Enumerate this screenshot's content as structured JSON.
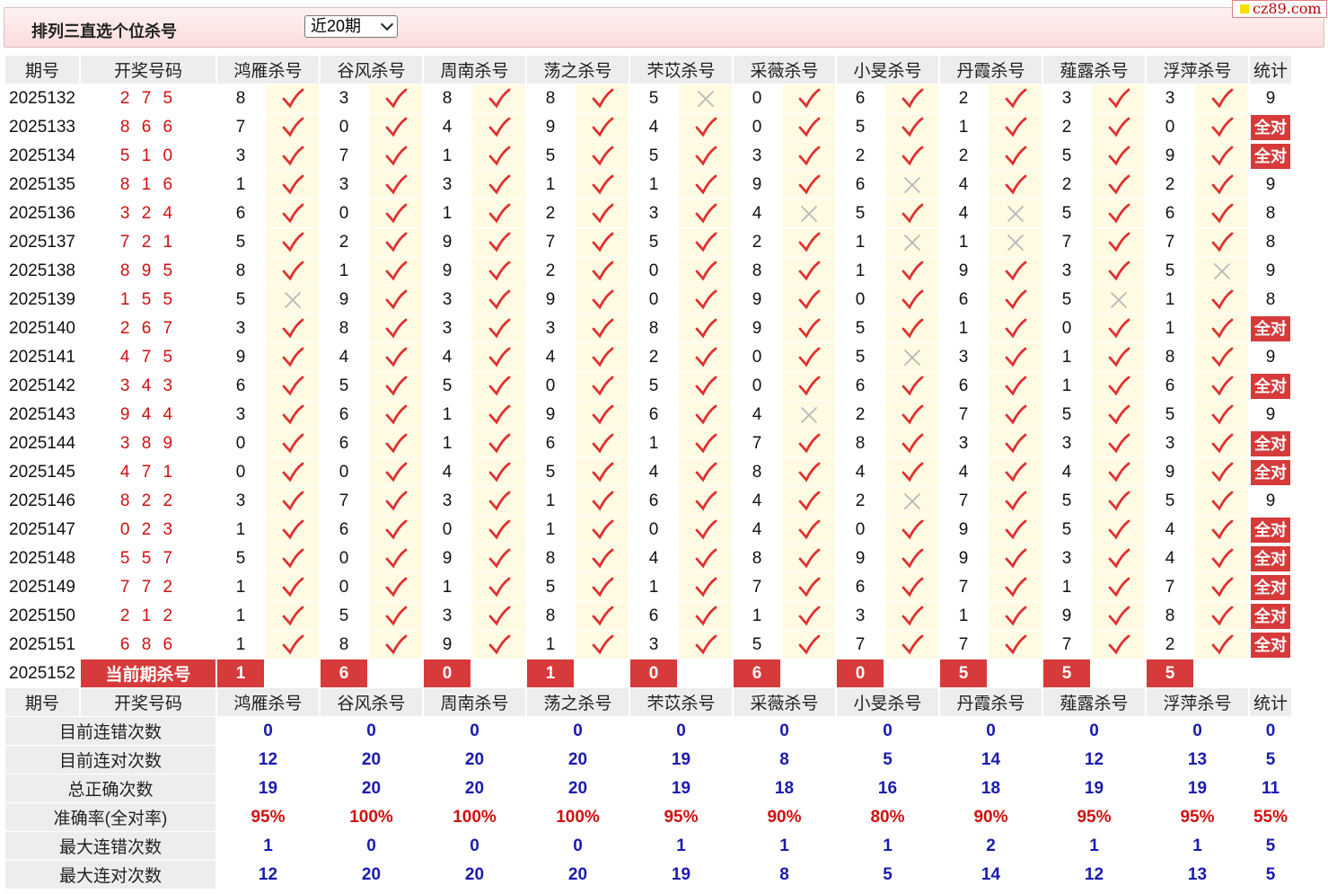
{
  "header": {
    "title": "排列三直选个位杀号",
    "period_select": "近20期"
  },
  "watermark": "cz89.com",
  "columns": [
    "期号",
    "开奖号码",
    "鸿雁杀号",
    "谷风杀号",
    "周南杀号",
    "荡之杀号",
    "芣苡杀号",
    "采薇杀号",
    "小旻杀号",
    "丹霞杀号",
    "薤露杀号",
    "浮萍杀号",
    "统计"
  ],
  "full_label": "全对",
  "rows": [
    {
      "issue": "2025132",
      "draw": "2 7 5",
      "kills": [
        [
          8,
          1
        ],
        [
          3,
          1
        ],
        [
          8,
          1
        ],
        [
          8,
          1
        ],
        [
          5,
          0
        ],
        [
          0,
          1
        ],
        [
          6,
          1
        ],
        [
          2,
          1
        ],
        [
          3,
          1
        ],
        [
          3,
          1
        ]
      ],
      "stat": "9"
    },
    {
      "issue": "2025133",
      "draw": "8 6 6",
      "kills": [
        [
          7,
          1
        ],
        [
          0,
          1
        ],
        [
          4,
          1
        ],
        [
          9,
          1
        ],
        [
          4,
          1
        ],
        [
          0,
          1
        ],
        [
          5,
          1
        ],
        [
          1,
          1
        ],
        [
          2,
          1
        ],
        [
          0,
          1
        ]
      ],
      "stat": "全对"
    },
    {
      "issue": "2025134",
      "draw": "5 1 0",
      "kills": [
        [
          3,
          1
        ],
        [
          7,
          1
        ],
        [
          1,
          1
        ],
        [
          5,
          1
        ],
        [
          5,
          1
        ],
        [
          3,
          1
        ],
        [
          2,
          1
        ],
        [
          2,
          1
        ],
        [
          5,
          1
        ],
        [
          9,
          1
        ]
      ],
      "stat": "全对"
    },
    {
      "issue": "2025135",
      "draw": "8 1 6",
      "kills": [
        [
          1,
          1
        ],
        [
          3,
          1
        ],
        [
          3,
          1
        ],
        [
          1,
          1
        ],
        [
          1,
          1
        ],
        [
          9,
          1
        ],
        [
          6,
          0
        ],
        [
          4,
          1
        ],
        [
          2,
          1
        ],
        [
          2,
          1
        ]
      ],
      "stat": "9"
    },
    {
      "issue": "2025136",
      "draw": "3 2 4",
      "kills": [
        [
          6,
          1
        ],
        [
          0,
          1
        ],
        [
          1,
          1
        ],
        [
          2,
          1
        ],
        [
          3,
          1
        ],
        [
          4,
          0
        ],
        [
          5,
          1
        ],
        [
          4,
          0
        ],
        [
          5,
          1
        ],
        [
          6,
          1
        ]
      ],
      "stat": "8"
    },
    {
      "issue": "2025137",
      "draw": "7 2 1",
      "kills": [
        [
          5,
          1
        ],
        [
          2,
          1
        ],
        [
          9,
          1
        ],
        [
          7,
          1
        ],
        [
          5,
          1
        ],
        [
          2,
          1
        ],
        [
          1,
          0
        ],
        [
          1,
          0
        ],
        [
          7,
          1
        ],
        [
          7,
          1
        ]
      ],
      "stat": "8"
    },
    {
      "issue": "2025138",
      "draw": "8 9 5",
      "kills": [
        [
          8,
          1
        ],
        [
          1,
          1
        ],
        [
          9,
          1
        ],
        [
          2,
          1
        ],
        [
          0,
          1
        ],
        [
          8,
          1
        ],
        [
          1,
          1
        ],
        [
          9,
          1
        ],
        [
          3,
          1
        ],
        [
          5,
          0
        ]
      ],
      "stat": "9"
    },
    {
      "issue": "2025139",
      "draw": "1 5 5",
      "kills": [
        [
          5,
          0
        ],
        [
          9,
          1
        ],
        [
          3,
          1
        ],
        [
          9,
          1
        ],
        [
          0,
          1
        ],
        [
          9,
          1
        ],
        [
          0,
          1
        ],
        [
          6,
          1
        ],
        [
          5,
          0
        ],
        [
          1,
          1
        ]
      ],
      "stat": "8"
    },
    {
      "issue": "2025140",
      "draw": "2 6 7",
      "kills": [
        [
          3,
          1
        ],
        [
          8,
          1
        ],
        [
          3,
          1
        ],
        [
          3,
          1
        ],
        [
          8,
          1
        ],
        [
          9,
          1
        ],
        [
          5,
          1
        ],
        [
          1,
          1
        ],
        [
          0,
          1
        ],
        [
          1,
          1
        ]
      ],
      "stat": "全对"
    },
    {
      "issue": "2025141",
      "draw": "4 7 5",
      "kills": [
        [
          9,
          1
        ],
        [
          4,
          1
        ],
        [
          4,
          1
        ],
        [
          4,
          1
        ],
        [
          2,
          1
        ],
        [
          0,
          1
        ],
        [
          5,
          0
        ],
        [
          3,
          1
        ],
        [
          1,
          1
        ],
        [
          8,
          1
        ]
      ],
      "stat": "9"
    },
    {
      "issue": "2025142",
      "draw": "3 4 3",
      "kills": [
        [
          6,
          1
        ],
        [
          5,
          1
        ],
        [
          5,
          1
        ],
        [
          0,
          1
        ],
        [
          5,
          1
        ],
        [
          0,
          1
        ],
        [
          6,
          1
        ],
        [
          6,
          1
        ],
        [
          1,
          1
        ],
        [
          6,
          1
        ]
      ],
      "stat": "全对"
    },
    {
      "issue": "2025143",
      "draw": "9 4 4",
      "kills": [
        [
          3,
          1
        ],
        [
          6,
          1
        ],
        [
          1,
          1
        ],
        [
          9,
          1
        ],
        [
          6,
          1
        ],
        [
          4,
          0
        ],
        [
          2,
          1
        ],
        [
          7,
          1
        ],
        [
          5,
          1
        ],
        [
          5,
          1
        ]
      ],
      "stat": "9"
    },
    {
      "issue": "2025144",
      "draw": "3 8 9",
      "kills": [
        [
          0,
          1
        ],
        [
          6,
          1
        ],
        [
          1,
          1
        ],
        [
          6,
          1
        ],
        [
          1,
          1
        ],
        [
          7,
          1
        ],
        [
          8,
          1
        ],
        [
          3,
          1
        ],
        [
          3,
          1
        ],
        [
          3,
          1
        ]
      ],
      "stat": "全对"
    },
    {
      "issue": "2025145",
      "draw": "4 7 1",
      "kills": [
        [
          0,
          1
        ],
        [
          0,
          1
        ],
        [
          4,
          1
        ],
        [
          5,
          1
        ],
        [
          4,
          1
        ],
        [
          8,
          1
        ],
        [
          4,
          1
        ],
        [
          4,
          1
        ],
        [
          4,
          1
        ],
        [
          9,
          1
        ]
      ],
      "stat": "全对"
    },
    {
      "issue": "2025146",
      "draw": "8 2 2",
      "kills": [
        [
          3,
          1
        ],
        [
          7,
          1
        ],
        [
          3,
          1
        ],
        [
          1,
          1
        ],
        [
          6,
          1
        ],
        [
          4,
          1
        ],
        [
          2,
          0
        ],
        [
          7,
          1
        ],
        [
          5,
          1
        ],
        [
          5,
          1
        ]
      ],
      "stat": "9"
    },
    {
      "issue": "2025147",
      "draw": "0 2 3",
      "kills": [
        [
          1,
          1
        ],
        [
          6,
          1
        ],
        [
          0,
          1
        ],
        [
          1,
          1
        ],
        [
          0,
          1
        ],
        [
          4,
          1
        ],
        [
          0,
          1
        ],
        [
          9,
          1
        ],
        [
          5,
          1
        ],
        [
          4,
          1
        ]
      ],
      "stat": "全对"
    },
    {
      "issue": "2025148",
      "draw": "5 5 7",
      "kills": [
        [
          5,
          1
        ],
        [
          0,
          1
        ],
        [
          9,
          1
        ],
        [
          8,
          1
        ],
        [
          4,
          1
        ],
        [
          8,
          1
        ],
        [
          9,
          1
        ],
        [
          9,
          1
        ],
        [
          3,
          1
        ],
        [
          4,
          1
        ]
      ],
      "stat": "全对"
    },
    {
      "issue": "2025149",
      "draw": "7 7 2",
      "kills": [
        [
          1,
          1
        ],
        [
          0,
          1
        ],
        [
          1,
          1
        ],
        [
          5,
          1
        ],
        [
          1,
          1
        ],
        [
          7,
          1
        ],
        [
          6,
          1
        ],
        [
          7,
          1
        ],
        [
          1,
          1
        ],
        [
          7,
          1
        ]
      ],
      "stat": "全对"
    },
    {
      "issue": "2025150",
      "draw": "2 1 2",
      "kills": [
        [
          1,
          1
        ],
        [
          5,
          1
        ],
        [
          3,
          1
        ],
        [
          8,
          1
        ],
        [
          6,
          1
        ],
        [
          1,
          1
        ],
        [
          3,
          1
        ],
        [
          1,
          1
        ],
        [
          9,
          1
        ],
        [
          8,
          1
        ]
      ],
      "stat": "全对"
    },
    {
      "issue": "2025151",
      "draw": "6 8 6",
      "kills": [
        [
          1,
          1
        ],
        [
          8,
          1
        ],
        [
          9,
          1
        ],
        [
          1,
          1
        ],
        [
          3,
          1
        ],
        [
          5,
          1
        ],
        [
          7,
          1
        ],
        [
          7,
          1
        ],
        [
          7,
          1
        ],
        [
          2,
          1
        ]
      ],
      "stat": "全对"
    }
  ],
  "current": {
    "issue": "2025152",
    "label": "当前期杀号",
    "kills": [
      "1",
      "6",
      "0",
      "1",
      "0",
      "6",
      "0",
      "5",
      "5",
      "5"
    ]
  },
  "summary": [
    {
      "label": "目前连错次数",
      "values": [
        "0",
        "0",
        "0",
        "0",
        "0",
        "0",
        "0",
        "0",
        "0",
        "0"
      ],
      "stat": "0",
      "pct": false
    },
    {
      "label": "目前连对次数",
      "values": [
        "12",
        "20",
        "20",
        "20",
        "19",
        "8",
        "5",
        "14",
        "12",
        "13"
      ],
      "stat": "5",
      "pct": false
    },
    {
      "label": "总正确次数",
      "values": [
        "19",
        "20",
        "20",
        "20",
        "19",
        "18",
        "16",
        "18",
        "19",
        "19"
      ],
      "stat": "11",
      "pct": false
    },
    {
      "label": "准确率(全对率)",
      "values": [
        "95%",
        "100%",
        "100%",
        "100%",
        "95%",
        "90%",
        "80%",
        "90%",
        "95%",
        "95%"
      ],
      "stat": "55%",
      "pct": true
    },
    {
      "label": "最大连错次数",
      "values": [
        "1",
        "0",
        "0",
        "0",
        "1",
        "1",
        "1",
        "2",
        "1",
        "1"
      ],
      "stat": "5",
      "pct": false
    },
    {
      "label": "最大连对次数",
      "values": [
        "12",
        "20",
        "20",
        "20",
        "19",
        "8",
        "5",
        "14",
        "12",
        "13"
      ],
      "stat": "5",
      "pct": false
    }
  ],
  "icons": {
    "correct": "check-icon",
    "wrong": "cross-icon"
  },
  "colors": {
    "check": "#e03030",
    "cross": "#b8b8b8",
    "accent": "#d73a3a",
    "summary_value": "#1a1ab0",
    "draw_number": "#d01010"
  }
}
